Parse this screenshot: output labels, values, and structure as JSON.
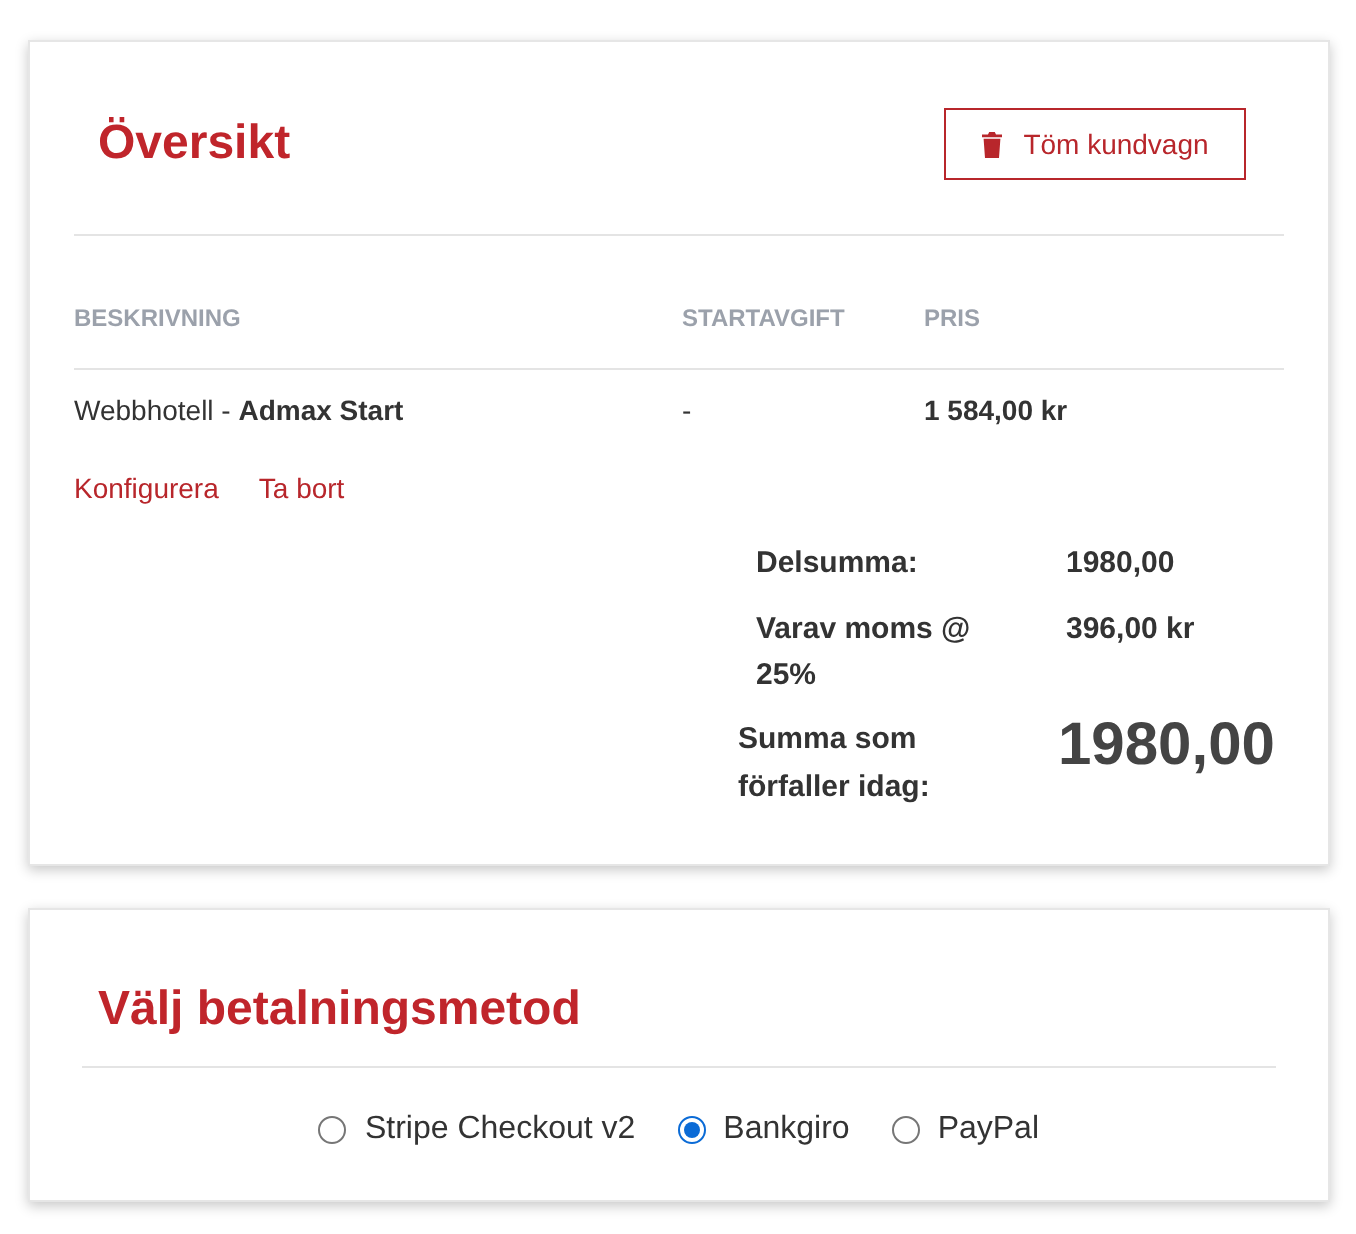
{
  "overview": {
    "title": "Översikt",
    "empty_cart_button": "Töm kundvagn",
    "columns": [
      "BESKRIVNING",
      "STARTAVGIFT",
      "PRIS"
    ],
    "items": [
      {
        "description": "Webbhotell - **Admax Start**",
        "setup_fee": "-",
        "price": "1 584,00 kr",
        "actions": [
          "Konfigurera",
          "Ta bort"
        ]
      }
    ],
    "totals": [
      {
        "kind": "subtotal",
        "label": "Delsumma:",
        "value": "1980,00"
      },
      {
        "kind": "tax",
        "label": "Varav moms @ 25%",
        "value": "396,00 kr"
      },
      {
        "kind": "total",
        "label": "Summa som förfaller idag:",
        "value": "1980,00"
      }
    ]
  },
  "payment": {
    "title": "Välj betalningsmetod",
    "methods": [
      {
        "label": "Stripe Checkout v2",
        "selected": false
      },
      {
        "label": "Bankgiro",
        "selected": true
      },
      {
        "label": "PayPal",
        "selected": false
      }
    ]
  }
}
